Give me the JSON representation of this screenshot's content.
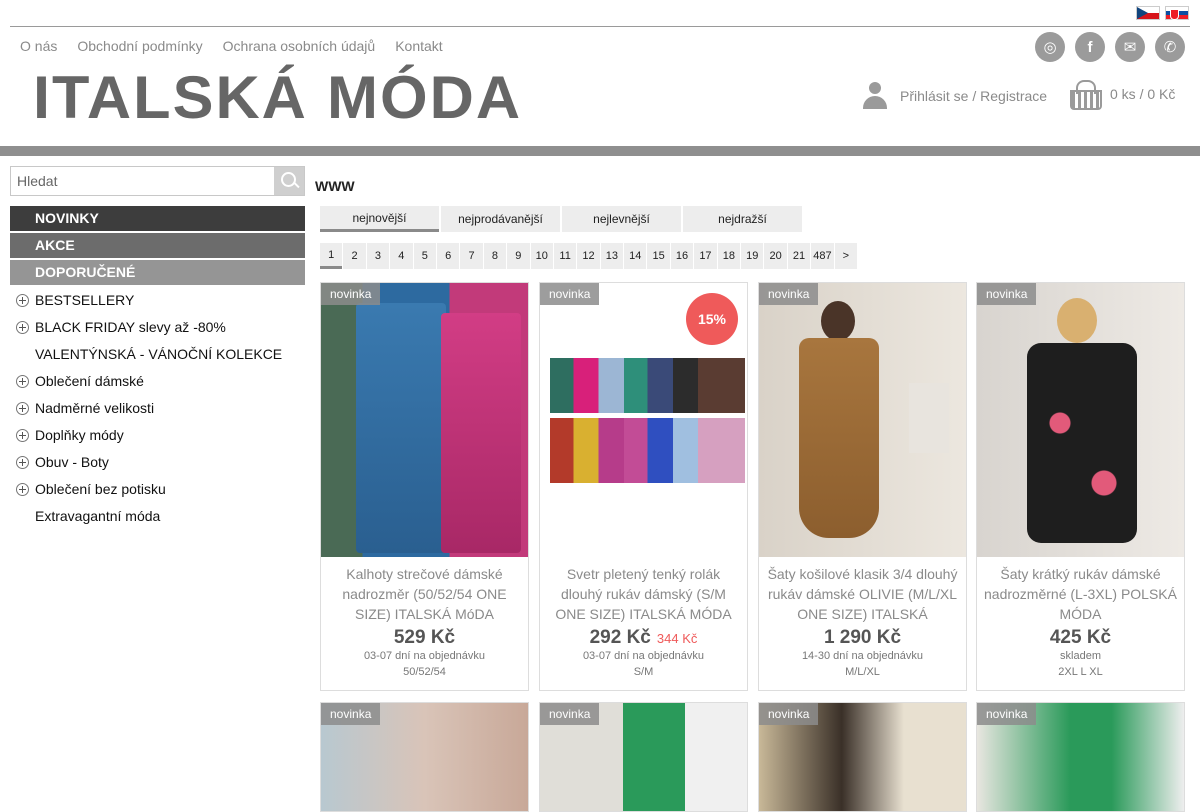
{
  "header": {
    "flags": [
      "flag-cz",
      "flag-sk"
    ],
    "nav": [
      "O nás",
      "Obchodní podmínky",
      "Ochrana osobních údajů",
      "Kontakt"
    ],
    "social_icons": [
      "instagram-icon",
      "facebook-icon",
      "mail-icon",
      "phone-icon"
    ],
    "social_glyphs": [
      "◎",
      "f",
      "✉",
      "✆"
    ],
    "logo": "ITALSKÁ MÓDA",
    "login": "Přihlásit se / Registrace",
    "cart": "0 ks / 0 Kč"
  },
  "sidebar": {
    "search_placeholder": "Hledat",
    "highlights": [
      "NOVINKY",
      "AKCE",
      "DOPORUČENÉ"
    ],
    "items": [
      {
        "label": "BESTSELLERY",
        "expandable": true
      },
      {
        "label": "BLACK FRIDAY slevy až -80%",
        "expandable": true
      },
      {
        "label": "VALENTÝNSKÁ - VÁNOČNÍ KOLEKCE",
        "expandable": false
      },
      {
        "label": "Oblečení dámské",
        "expandable": true
      },
      {
        "label": "Nadměrné velikosti",
        "expandable": true
      },
      {
        "label": "Doplňky módy",
        "expandable": true
      },
      {
        "label": "Obuv - Boty",
        "expandable": true
      },
      {
        "label": "Oblečení bez potisku",
        "expandable": true
      },
      {
        "label": "Extravagantní móda",
        "expandable": false
      }
    ]
  },
  "main": {
    "title": "www",
    "sort_tabs": [
      "nejnovější",
      "nejprodávanější",
      "nejlevnější",
      "nejdražší"
    ],
    "pager": [
      "1",
      "2",
      "3",
      "4",
      "5",
      "6",
      "7",
      "8",
      "9",
      "10",
      "11",
      "12",
      "13",
      "14",
      "15",
      "16",
      "17",
      "18",
      "19",
      "20",
      "21",
      "487",
      ">"
    ],
    "products": [
      {
        "badge": "novinka",
        "name": "Kalhoty strečové dámské nadrozměr (50/52/54 ONE SIZE) ITALSKÁ MóDA",
        "price": "529 Kč",
        "old_price": "",
        "sale": "",
        "availability": "03-07 dní na objednávku",
        "sizes": "50/52/54"
      },
      {
        "badge": "novinka",
        "name": "Svetr pletený tenký rolák dlouhý rukáv dámský (S/M ONE SIZE) ITALSKÁ MÓDA",
        "price": "292 Kč",
        "old_price": "344 Kč",
        "sale": "15%",
        "availability": "03-07 dní na objednávku",
        "sizes": "S/M"
      },
      {
        "badge": "novinka",
        "name": "Šaty košilové klasik 3/4 dlouhý rukáv dámské OLIVIE (M/L/XL ONE SIZE) ITALSKÁ",
        "price": "1 290 Kč",
        "old_price": "",
        "sale": "",
        "availability": "14-30 dní na objednávku",
        "sizes": "M/L/XL"
      },
      {
        "badge": "novinka",
        "name": "Šaty krátký rukáv dámské nadrozměrné (L-3XL) POLSKÁ MÓDA",
        "price": "425 Kč",
        "old_price": "",
        "sale": "",
        "availability": "skladem",
        "sizes": "2XL L XL"
      }
    ],
    "second_row_badges": [
      "novinka",
      "novinka",
      "novinka",
      "novinka"
    ]
  }
}
